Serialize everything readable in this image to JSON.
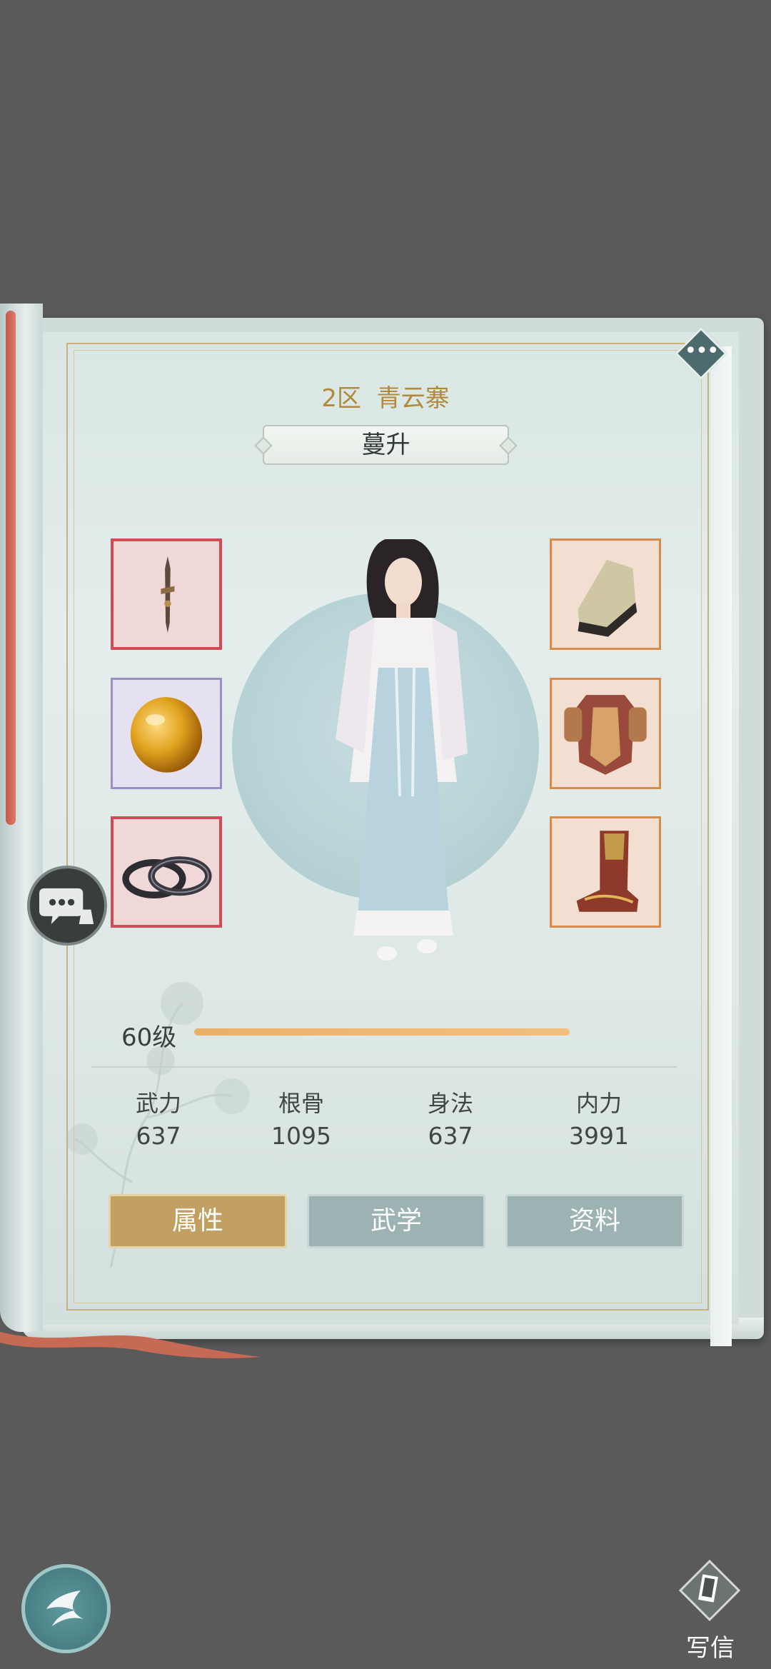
{
  "header": {
    "server": "2区",
    "sect": "青云寨",
    "character_name": "蔓升"
  },
  "equipment": {
    "left": [
      {
        "name": "dagger",
        "rarity_color": "#d14a55"
      },
      {
        "name": "amber-gem",
        "rarity_color": "#9a8fc2"
      },
      {
        "name": "bracelet-rings",
        "rarity_color": "#d14a55"
      }
    ],
    "right": [
      {
        "name": "bracer",
        "rarity_color": "#d98b4a"
      },
      {
        "name": "armor-chest",
        "rarity_color": "#d98b4a"
      },
      {
        "name": "boots",
        "rarity_color": "#d98b4a"
      }
    ]
  },
  "level": {
    "label": "60级",
    "progress": 1.0
  },
  "stats": [
    {
      "label": "武力",
      "value": "637"
    },
    {
      "label": "根骨",
      "value": "1095"
    },
    {
      "label": "身法",
      "value": "637"
    },
    {
      "label": "内力",
      "value": "3991"
    }
  ],
  "tabs": [
    {
      "label": "属性",
      "active": true
    },
    {
      "label": "武学",
      "active": false
    },
    {
      "label": "资料",
      "active": false
    }
  ],
  "bottom": {
    "write_label": "写信"
  },
  "icons": {
    "more": "more-dots-icon",
    "chat": "chat-bubble-icon",
    "back": "back-arrow-icon",
    "write": "letter-card-icon"
  },
  "colors": {
    "gold_text": "#b08a3e",
    "active_tab": "#c2a062",
    "inactive_tab": "#9cb2b3"
  }
}
